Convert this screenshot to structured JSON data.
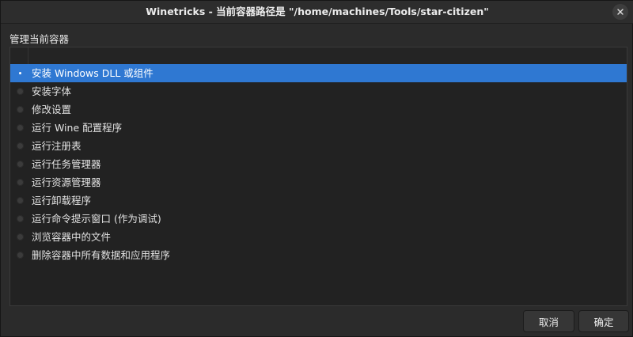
{
  "window": {
    "title": "Winetricks - 当前容器路径是 \"/home/machines/Tools/star-citizen\""
  },
  "section_label": "管理当前容器",
  "options": [
    {
      "label": "安装 Windows DLL 或组件",
      "selected": true
    },
    {
      "label": "安装字体",
      "selected": false
    },
    {
      "label": "修改设置",
      "selected": false
    },
    {
      "label": "运行 Wine 配置程序",
      "selected": false
    },
    {
      "label": "运行注册表",
      "selected": false
    },
    {
      "label": "运行任务管理器",
      "selected": false
    },
    {
      "label": "运行资源管理器",
      "selected": false
    },
    {
      "label": "运行卸载程序",
      "selected": false
    },
    {
      "label": "运行命令提示窗口 (作为调试)",
      "selected": false
    },
    {
      "label": "浏览容器中的文件",
      "selected": false
    },
    {
      "label": "删除容器中所有数据和应用程序",
      "selected": false
    }
  ],
  "buttons": {
    "cancel": "取消",
    "ok": "确定"
  },
  "colors": {
    "selection": "#2f78d2",
    "background": "#2b2b2b"
  },
  "icons": {
    "close": "close-icon"
  }
}
